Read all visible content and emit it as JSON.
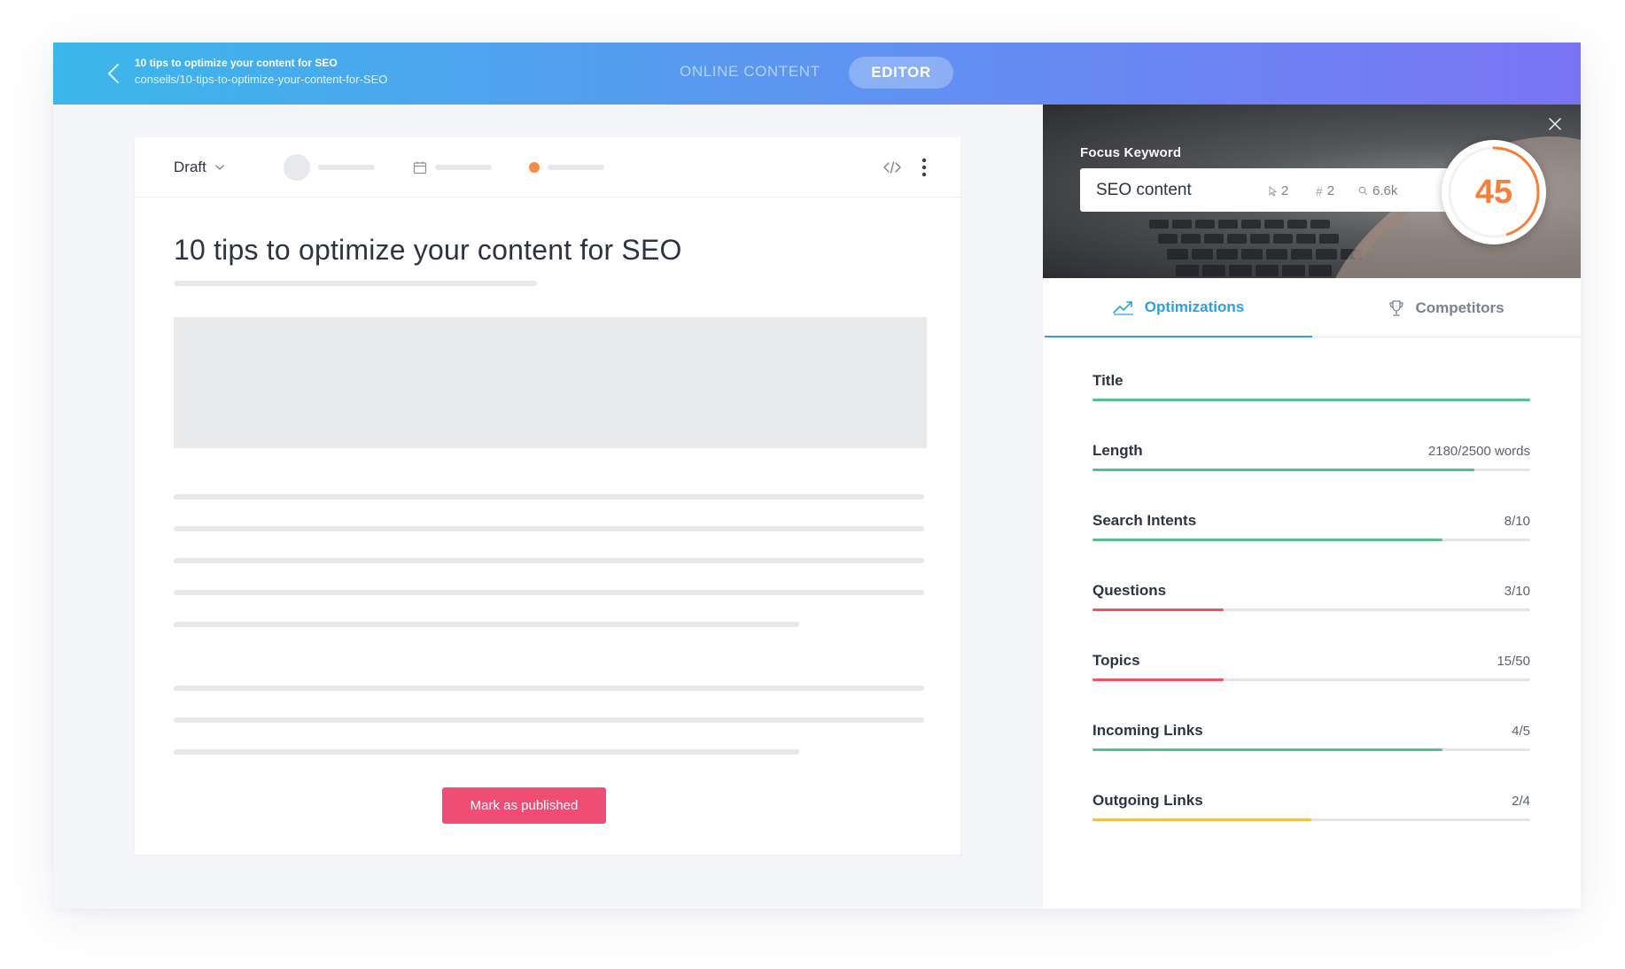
{
  "header": {
    "doc_title": "10 tips to optimize your content for SEO",
    "doc_path": "conseils/10-tips-to-optimize-your-content-for-SEO",
    "tabs": [
      {
        "label": "ONLINE CONTENT",
        "active": false
      },
      {
        "label": "EDITOR",
        "active": true
      }
    ]
  },
  "editor": {
    "status": "Draft",
    "article_title": "10 tips to optimize your content for SEO",
    "publish_button": "Mark as published"
  },
  "panel": {
    "focus_label": "Focus Keyword",
    "keyword": "SEO content",
    "stats": [
      {
        "icon": "cursor-icon",
        "value": "2"
      },
      {
        "icon": "hash-icon",
        "value": "2"
      },
      {
        "icon": "search-icon",
        "value": "6.6k"
      }
    ],
    "score": "45",
    "score_color": "#f4803a",
    "tabs": [
      {
        "label": "Optimizations",
        "icon": "trend-icon",
        "active": true
      },
      {
        "label": "Competitors",
        "icon": "trophy-icon",
        "active": false
      }
    ],
    "metrics": [
      {
        "label": "Title",
        "value": "",
        "progress": 1.0,
        "color": "#55c08f"
      },
      {
        "label": "Length",
        "value": "2180/2500 words",
        "progress": 0.872,
        "color": "#55c08f"
      },
      {
        "label": "Search Intents",
        "value": "8/10",
        "progress": 0.8,
        "color": "#55c08f"
      },
      {
        "label": "Questions",
        "value": "3/10",
        "progress": 0.3,
        "color": "#f05060"
      },
      {
        "label": "Topics",
        "value": "15/50",
        "progress": 0.3,
        "color": "#f05060"
      },
      {
        "label": "Incoming Links",
        "value": "4/5",
        "progress": 0.8,
        "color": "#55c08f"
      },
      {
        "label": "Outgoing Links",
        "value": "2/4",
        "progress": 0.5,
        "color": "#f2c14b"
      }
    ]
  }
}
